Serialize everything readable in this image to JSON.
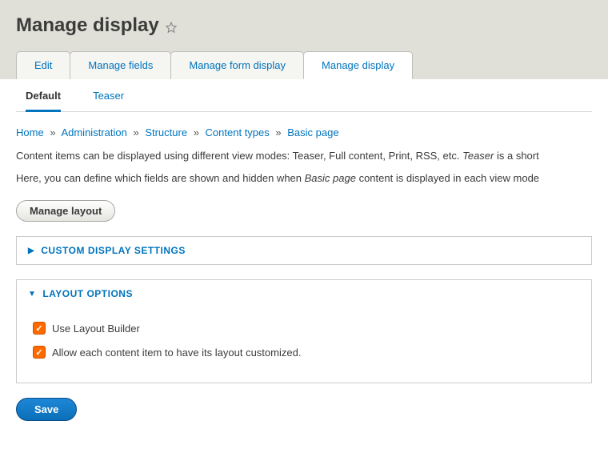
{
  "page_title": "Manage display",
  "primary_tabs": {
    "edit": "Edit",
    "manage_fields": "Manage fields",
    "manage_form_display": "Manage form display",
    "manage_display": "Manage display"
  },
  "secondary_tabs": {
    "default": "Default",
    "teaser": "Teaser"
  },
  "breadcrumb": {
    "home": "Home",
    "administration": "Administration",
    "structure": "Structure",
    "content_types": "Content types",
    "basic_page": "Basic page"
  },
  "help_line1_prefix": "Content items can be displayed using different view modes: Teaser, Full content, Print, RSS, etc. ",
  "help_line1_em": "Teaser",
  "help_line1_suffix": " is a short ",
  "help_line2_prefix": "Here, you can define which fields are shown and hidden when ",
  "help_line2_em": "Basic page",
  "help_line2_suffix": " content is displayed in each view mode",
  "manage_layout_button": "Manage layout",
  "custom_display_settings_title": "CUSTOM DISPLAY SETTINGS",
  "layout_options_title": "LAYOUT OPTIONS",
  "use_layout_builder_label": "Use Layout Builder",
  "allow_custom_label": "Allow each content item to have its layout customized.",
  "save_button": "Save"
}
